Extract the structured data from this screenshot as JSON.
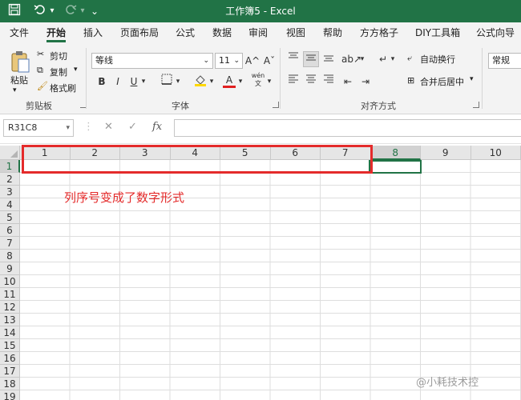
{
  "window": {
    "title": "工作簿5  -  Excel"
  },
  "quick_access": {
    "more": "⌄"
  },
  "ribbon_tabs": [
    "文件",
    "开始",
    "插入",
    "页面布局",
    "公式",
    "数据",
    "审阅",
    "视图",
    "帮助",
    "方方格子",
    "DIY工具箱",
    "公式向导"
  ],
  "active_tab": "开始",
  "clipboard": {
    "paste": "粘贴",
    "cut": "剪切",
    "copy": "复制",
    "format_painter": "格式刷",
    "group": "剪贴板"
  },
  "font": {
    "name": "等线",
    "size": "11",
    "bold": "B",
    "italic": "I",
    "underline": "U",
    "grow": "A^",
    "shrink": "Aˇ",
    "font_color_letter": "A",
    "wen": "wén",
    "group": "字体"
  },
  "alignment": {
    "wrap_text": "自动换行",
    "merge_center": "合并后居中",
    "group": "对齐方式"
  },
  "number": {
    "format": "常规"
  },
  "formula_bar": {
    "name_box": "R31C8",
    "cancel": "✕",
    "enter": "✓",
    "fx": "fx",
    "value": ""
  },
  "columns": [
    "1",
    "2",
    "3",
    "4",
    "5",
    "6",
    "7",
    "8",
    "9",
    "10"
  ],
  "selected_column": "8",
  "rows": [
    "1",
    "2",
    "3",
    "4",
    "5",
    "6",
    "7",
    "8",
    "9",
    "10",
    "11",
    "12",
    "13",
    "14",
    "15",
    "16",
    "17",
    "18",
    "19"
  ],
  "annotation": "列序号变成了数字形式",
  "watermark": "@小耗技术控",
  "colors": {
    "accent": "#217346",
    "highlight": "#e42b2b"
  }
}
